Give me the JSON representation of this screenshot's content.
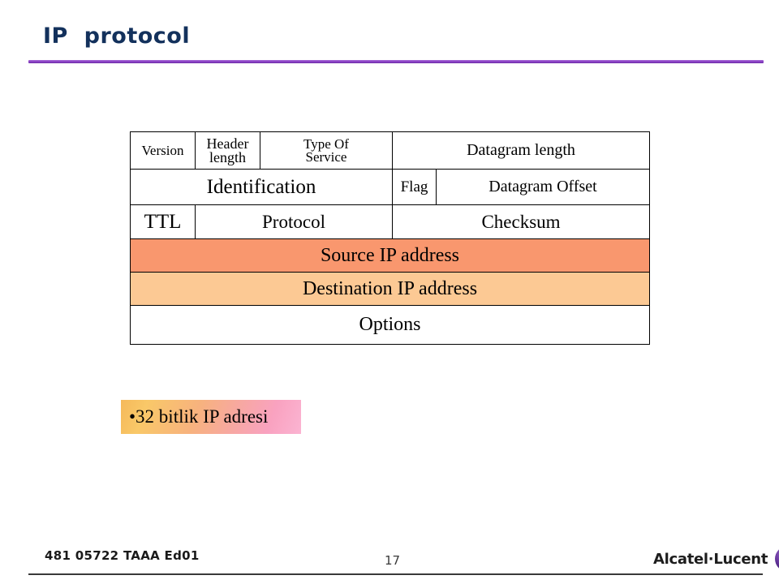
{
  "slide": {
    "title": "IP  protocol",
    "accent_color": "#8f43c9",
    "title_color": "#13315c"
  },
  "ip_header_table": {
    "rows": [
      {
        "name": "row-word-0",
        "cells": [
          {
            "label": "Version",
            "colspan": 1,
            "fill": "#ffffff"
          },
          {
            "label_line1": "Header",
            "label_line2": "length",
            "colspan": 1,
            "fill": "#ffffff"
          },
          {
            "label_line1": "Type Of",
            "label_line2": "Service",
            "colspan": 1,
            "fill": "#ffffff"
          },
          {
            "label": "Datagram length",
            "colspan": 2,
            "fill": "#ffffff"
          }
        ]
      },
      {
        "name": "row-word-1",
        "cells": [
          {
            "label": "Identification",
            "colspan": 3,
            "fill": "#ffffff"
          },
          {
            "label": "Flag",
            "colspan": 1,
            "fill": "#ffffff"
          },
          {
            "label": "Datagram Offset",
            "colspan": 1,
            "fill": "#ffffff"
          }
        ]
      },
      {
        "name": "row-word-2",
        "cells": [
          {
            "label": "TTL",
            "colspan": 1,
            "fill": "#ffffff"
          },
          {
            "label": "Protocol",
            "colspan": 2,
            "fill": "#ffffff"
          },
          {
            "label": "Checksum",
            "colspan": 2,
            "fill": "#ffffff"
          }
        ]
      },
      {
        "name": "row-word-3",
        "cells": [
          {
            "label": "Source IP address",
            "colspan": 5,
            "fill": "#f9976e"
          }
        ]
      },
      {
        "name": "row-word-4",
        "cells": [
          {
            "label": "Destination IP address",
            "colspan": 5,
            "fill": "#fcc994"
          }
        ]
      },
      {
        "name": "row-word-5",
        "cells": [
          {
            "label": "Options",
            "colspan": 5,
            "fill": "#ffffff"
          }
        ]
      }
    ],
    "labels": {
      "version": "Version",
      "header_length_line1": "Header",
      "header_length_line2": "length",
      "type_of_service_line1": "Type Of",
      "type_of_service_line2": "Service",
      "datagram_length": "Datagram length",
      "identification": "Identification",
      "flag": "Flag",
      "datagram_offset": "Datagram Offset",
      "ttl": "TTL",
      "protocol": "Protocol",
      "checksum": "Checksum",
      "source_ip": "Source IP address",
      "destination_ip": "Destination IP address",
      "options": "Options"
    }
  },
  "note": {
    "text": "•32 bitlik IP adresi",
    "gradient_from": "#f5b95a",
    "gradient_to": "#fbb4d2"
  },
  "footer": {
    "document_code": "481 05722 TAAA Ed01",
    "page_number": "17",
    "brand": "Alcatel·Lucent",
    "brand_mark_color": "#5b2d8e"
  }
}
